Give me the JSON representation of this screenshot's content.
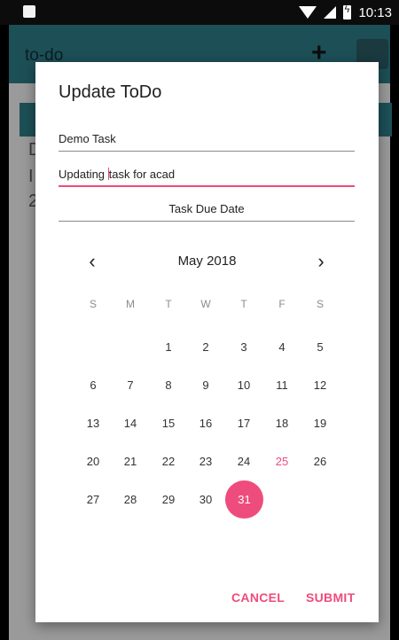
{
  "status_bar": {
    "time": "10:13"
  },
  "app": {
    "title": "to-do",
    "rows": [
      "D",
      "I",
      "2"
    ]
  },
  "dialog": {
    "title": "Update ToDo",
    "name_field": {
      "value": "Demo Task"
    },
    "desc_field": {
      "value_before_caret": "Updating ",
      "value_after_caret": "task for acad"
    },
    "due_date_field": {
      "value": "Task Due Date"
    },
    "calendar": {
      "month_label": "May 2018",
      "prev_icon": "chevron-left-icon",
      "next_icon": "chevron-right-icon",
      "weekdays": [
        "S",
        "M",
        "T",
        "W",
        "T",
        "F",
        "S"
      ],
      "weeks": [
        [
          "",
          "",
          "1",
          "2",
          "3",
          "4",
          "5"
        ],
        [
          "6",
          "7",
          "8",
          "9",
          "10",
          "11",
          "12"
        ],
        [
          "13",
          "14",
          "15",
          "16",
          "17",
          "18",
          "19"
        ],
        [
          "20",
          "21",
          "22",
          "23",
          "24",
          "25",
          "26"
        ],
        [
          "27",
          "28",
          "29",
          "30",
          "31",
          "",
          ""
        ]
      ],
      "today": "25",
      "selected": "31",
      "accent_color": "#ee4c7c"
    },
    "buttons": {
      "cancel": "CANCEL",
      "submit": "SUBMIT"
    }
  }
}
